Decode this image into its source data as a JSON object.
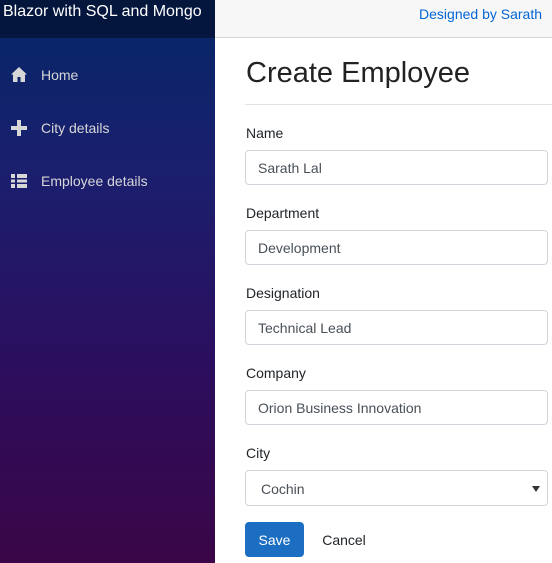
{
  "app": {
    "brand": "Blazor with SQL and Mongo",
    "designer_link": "Designed by Sarath"
  },
  "sidebar": {
    "items": [
      {
        "label": "Home",
        "icon": "home-icon"
      },
      {
        "label": "City details",
        "icon": "plus-icon"
      },
      {
        "label": "Employee details",
        "icon": "list-icon"
      }
    ]
  },
  "page": {
    "title": "Create Employee"
  },
  "form": {
    "name": {
      "label": "Name",
      "value": "Sarath Lal"
    },
    "department": {
      "label": "Department",
      "value": "Development"
    },
    "designation": {
      "label": "Designation",
      "value": "Technical Lead"
    },
    "company": {
      "label": "Company",
      "value": "Orion Business Innovation"
    },
    "city": {
      "label": "City",
      "value": "Cochin"
    },
    "save_label": "Save",
    "cancel_label": "Cancel"
  },
  "colors": {
    "primary": "#1b6ec2",
    "link": "#0366d6",
    "sidebar_top": "#052767",
    "sidebar_bottom": "#3a0647"
  }
}
